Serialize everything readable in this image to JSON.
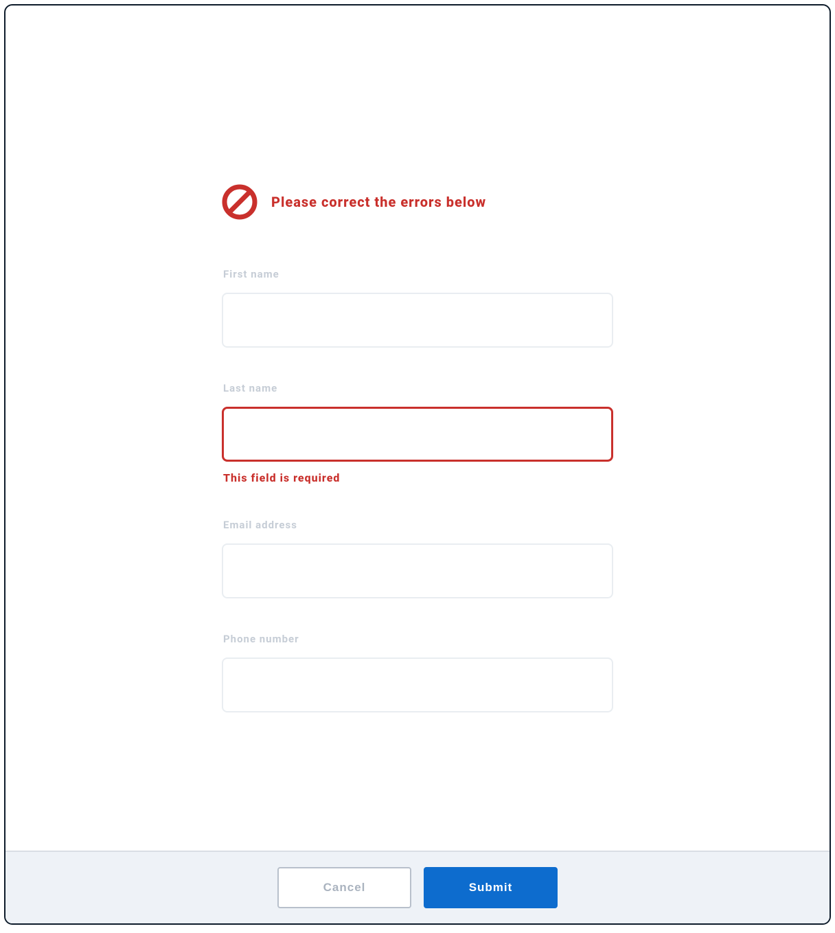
{
  "alert": {
    "message": "Please correct the errors below"
  },
  "fields": {
    "field1": {
      "label": "First name",
      "value": "",
      "placeholder": ""
    },
    "field2": {
      "label": "Last name",
      "value": "",
      "placeholder": "",
      "error_message": "This field is required"
    },
    "field3": {
      "label": "Email address",
      "value": "",
      "placeholder": ""
    },
    "field4": {
      "label": "Phone number",
      "value": "",
      "placeholder": ""
    }
  },
  "footer": {
    "secondary_label": "Cancel",
    "primary_label": "Submit"
  },
  "colors": {
    "error": "#c9302c",
    "primary": "#0d6cce",
    "footer_bg": "#eef2f7",
    "border_default": "#e9edf1",
    "label_muted": "#c6cdd6"
  }
}
